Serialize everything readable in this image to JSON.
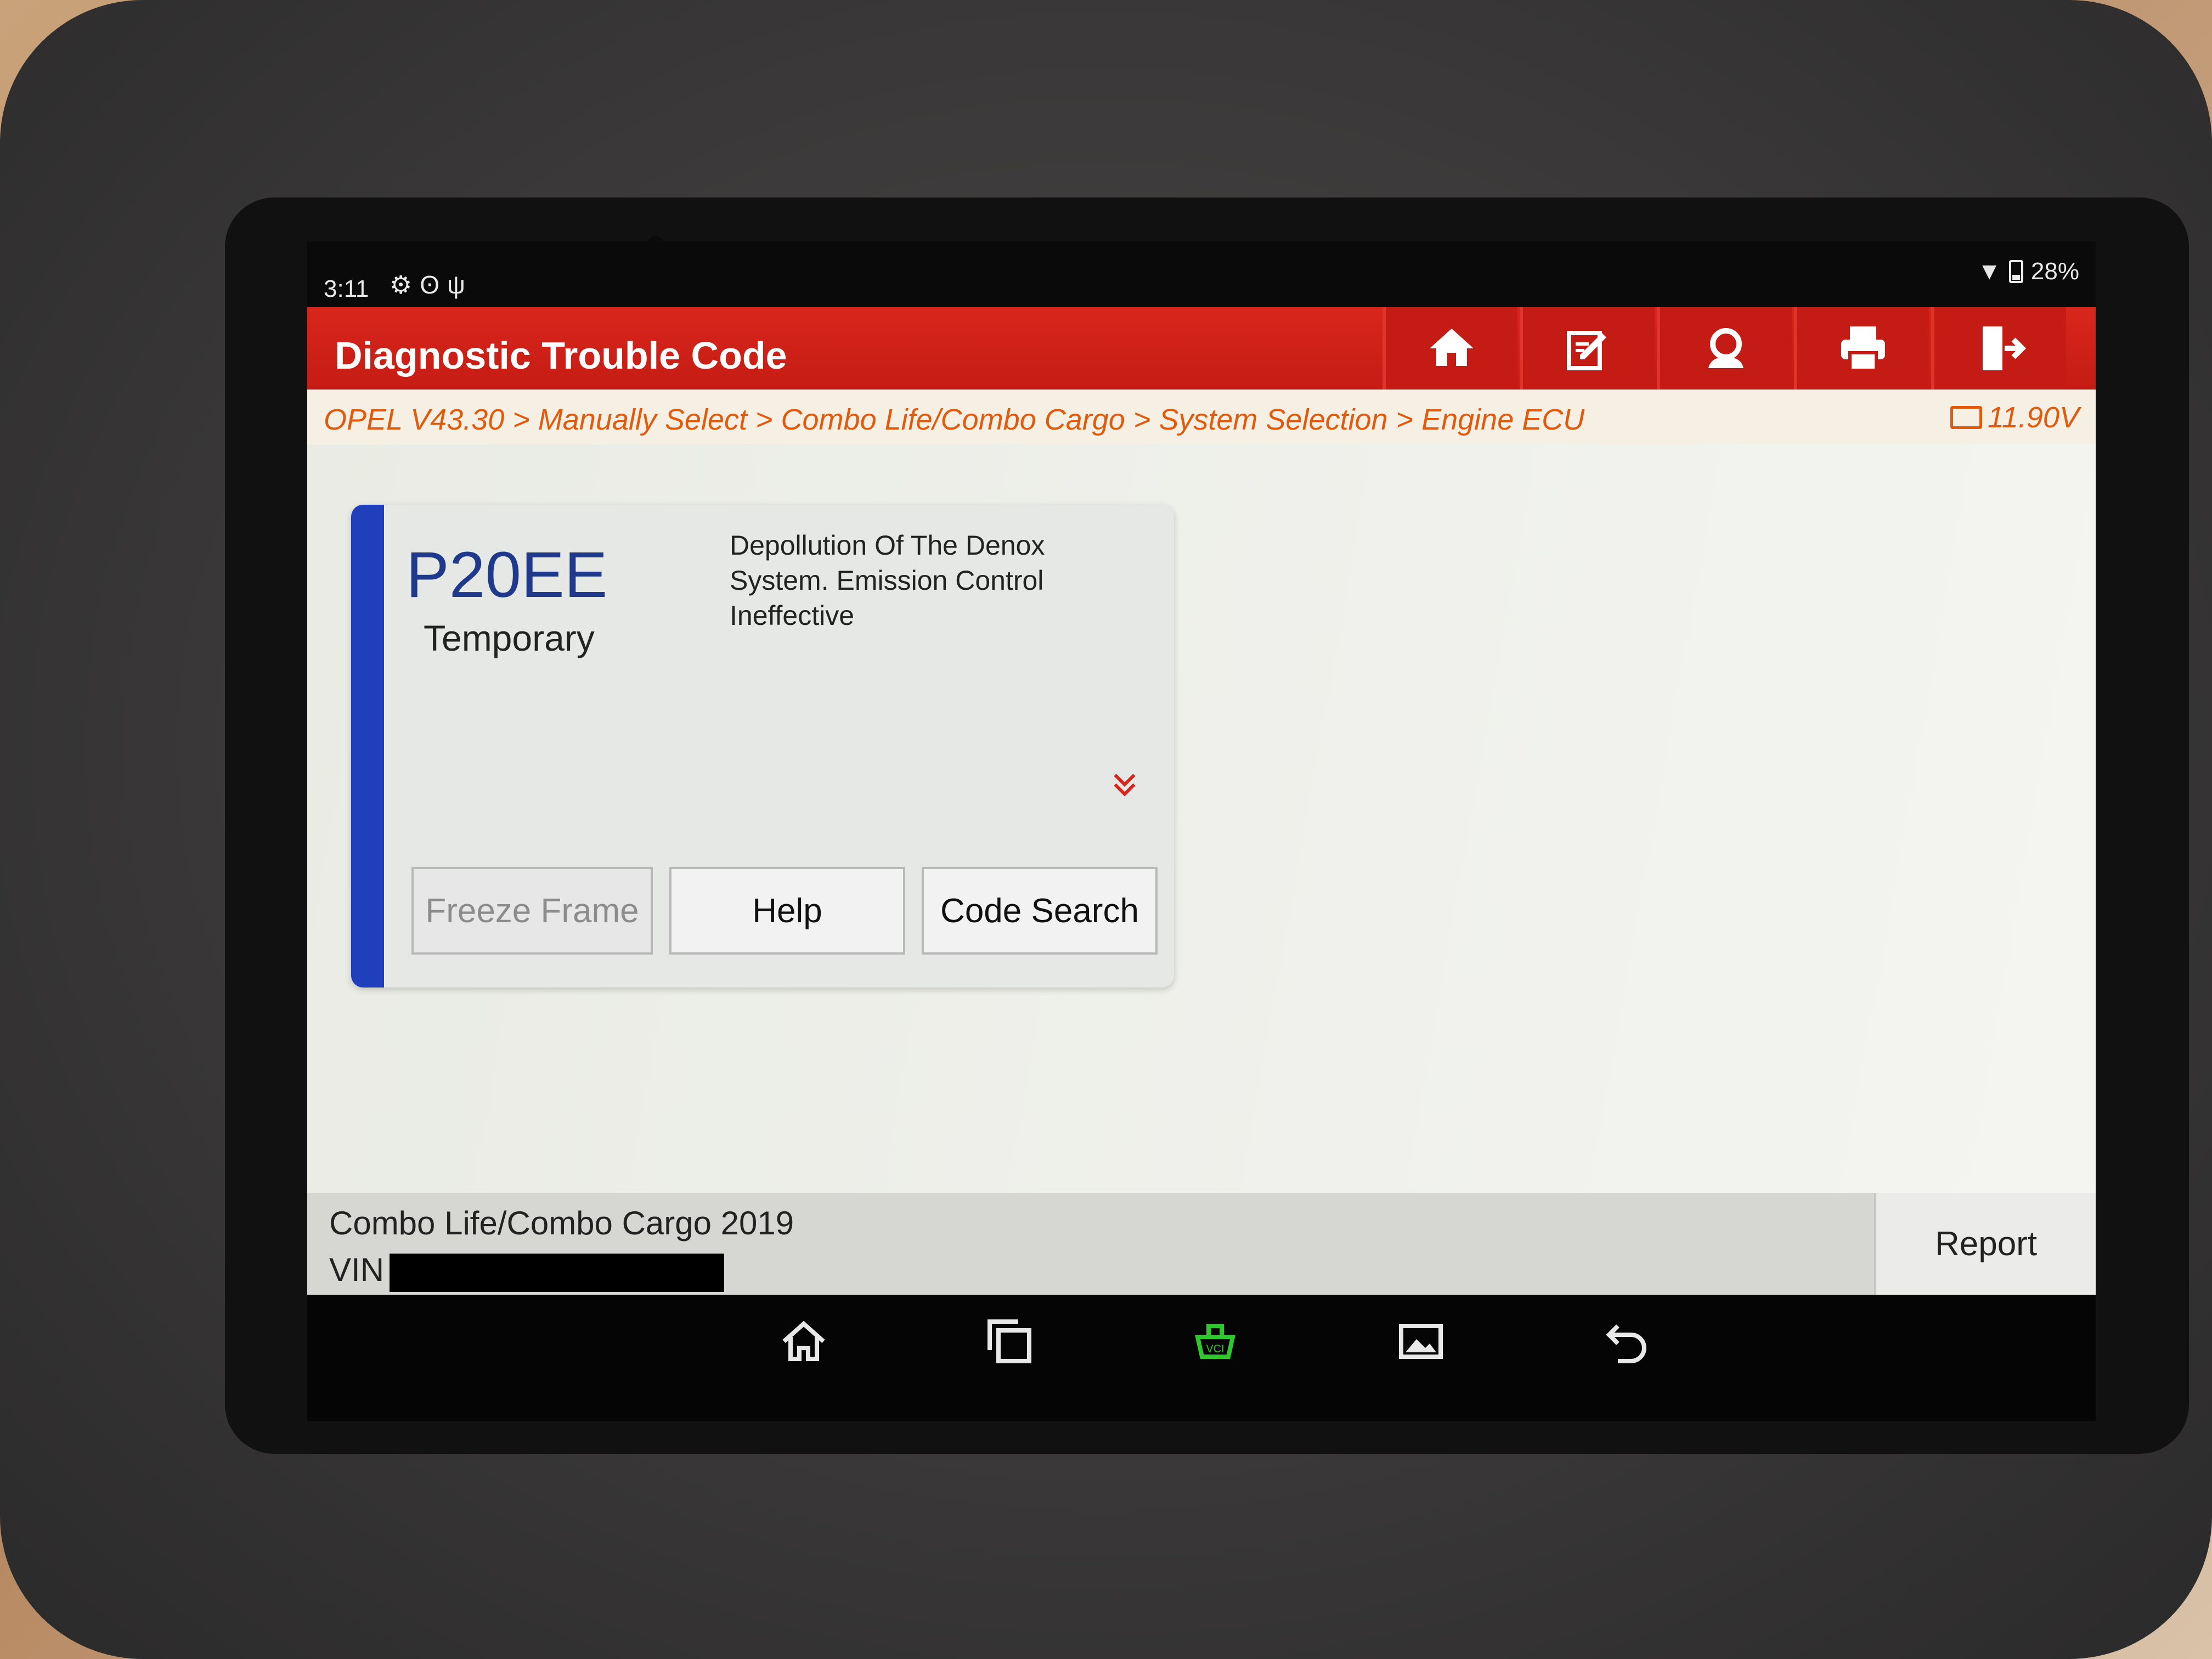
{
  "status_bar": {
    "time": "3:11",
    "icons": [
      "gear-icon",
      "bluetooth-icon",
      "usb-icon"
    ],
    "battery_percent": "28%"
  },
  "header": {
    "title": "Diagnostic Trouble Code",
    "buttons": [
      "home-icon",
      "edit-icon",
      "support-icon",
      "print-icon",
      "exit-icon"
    ],
    "accent_color": "#c41c14"
  },
  "breadcrumb": {
    "path": "OPEL V43.30 > Manually Select > Combo Life/Combo Cargo > System Selection > Engine ECU",
    "voltage": "11.90V",
    "color": "#e25a0c"
  },
  "dtc": {
    "code": "P20EE",
    "status": "Temporary",
    "description": "Depollution Of The Denox System. Emission Control Ineffective",
    "buttons": {
      "freeze_frame": "Freeze Frame",
      "help": "Help",
      "code_search": "Code Search"
    },
    "stripe_color": "#1f3fbd"
  },
  "footer": {
    "model": "Combo Life/Combo Cargo 2019",
    "vin_label": "VIN",
    "report": "Report"
  },
  "nav": {
    "buttons": [
      "home-outline-icon",
      "recent-apps-icon",
      "vci-icon",
      "screenshot-icon",
      "back-icon"
    ],
    "vci_color": "#2ec82e"
  }
}
